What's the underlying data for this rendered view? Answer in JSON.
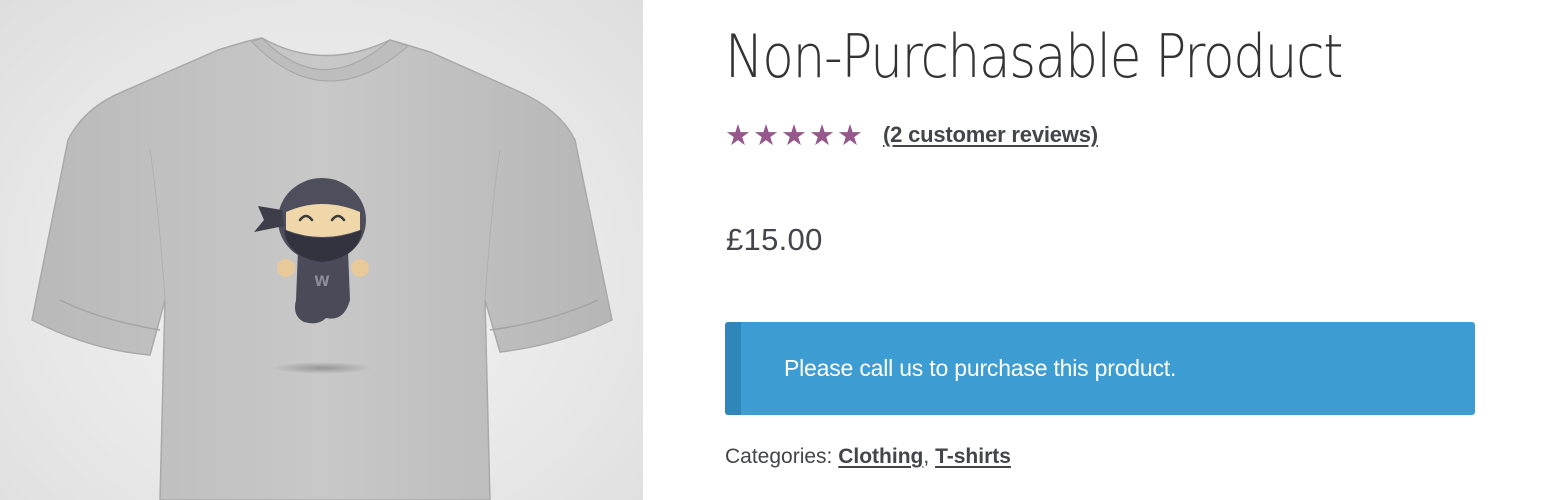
{
  "product": {
    "image_alt": "T-shirt with ninja mascot",
    "title": "Non-Purchasable Product",
    "rating": {
      "stars_filled": 5,
      "stars_total": 5,
      "star_glyph": "★",
      "reviews_link": "(2 customer reviews)"
    },
    "price": "£15.00",
    "notice": "Please call us to purchase this product.",
    "meta": {
      "categories_label": "Categories:",
      "separator": ",",
      "categories": [
        "Clothing",
        "T-shirts"
      ]
    }
  },
  "colors": {
    "accent_purple": "#96588a",
    "notice_blue": "#3d9cd2",
    "notice_border": "#2f86b9",
    "text": "#43454b",
    "title": "#333333"
  },
  "icons": {
    "star": "star-icon",
    "mascot": "ninja-mascot-icon"
  }
}
